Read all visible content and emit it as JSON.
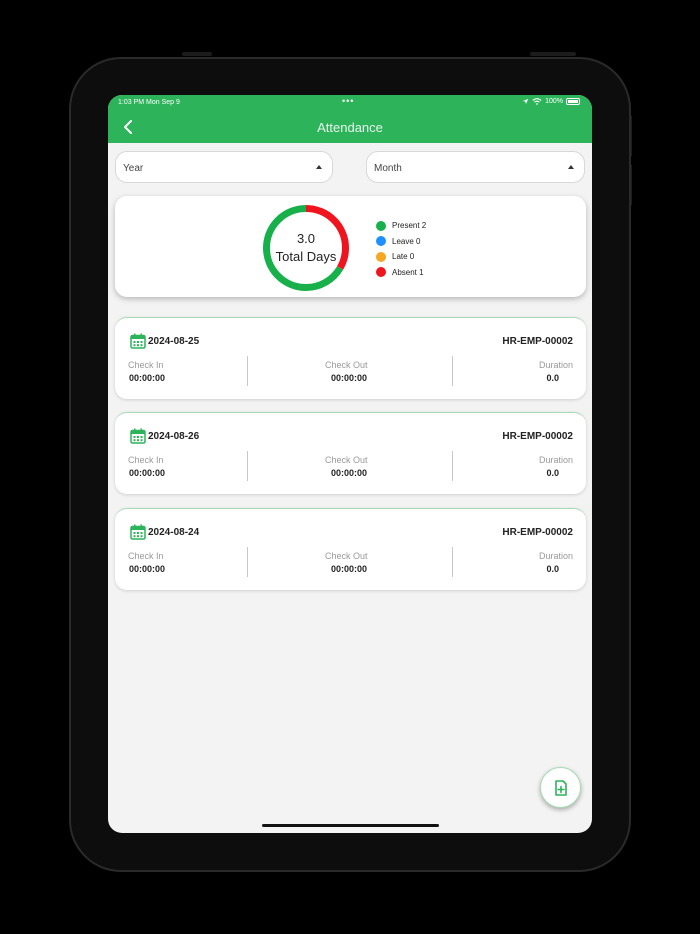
{
  "statusbar": {
    "time": "1:03 PM   Mon Sep 9",
    "dots": "•••",
    "battery": "100%"
  },
  "header": {
    "title": "Attendance"
  },
  "filters": {
    "year_label": "Year",
    "month_label": "Month"
  },
  "summary": {
    "total_value": "3.0",
    "total_label": "Total Days",
    "legend": [
      {
        "label": "Present 2",
        "color": "#18b04a"
      },
      {
        "label": "Leave 0",
        "color": "#1e90ff"
      },
      {
        "label": "Late 0",
        "color": "#f5a623"
      },
      {
        "label": "Absent 1",
        "color": "#f0141e"
      }
    ],
    "ring": {
      "present_fraction": 0.6667,
      "absent_fraction": 0.3333,
      "present_color": "#18b04a",
      "absent_color": "#f0141e"
    }
  },
  "labels": {
    "check_in": "Check In",
    "check_out": "Check Out",
    "duration": "Duration"
  },
  "records": [
    {
      "date": "2024-08-25",
      "employee": "HR-EMP-00002",
      "check_in": "00:00:00",
      "check_out": "00:00:00",
      "duration": "0.0"
    },
    {
      "date": "2024-08-26",
      "employee": "HR-EMP-00002",
      "check_in": "00:00:00",
      "check_out": "00:00:00",
      "duration": "0.0"
    },
    {
      "date": "2024-08-24",
      "employee": "HR-EMP-00002",
      "check_in": "00:00:00",
      "check_out": "00:00:00",
      "duration": "0.0"
    }
  ],
  "icons": {
    "back": "chevron-left-icon",
    "calendar": "calendar-icon",
    "fab": "add-document-icon"
  },
  "colors": {
    "accent": "#2db35a"
  }
}
